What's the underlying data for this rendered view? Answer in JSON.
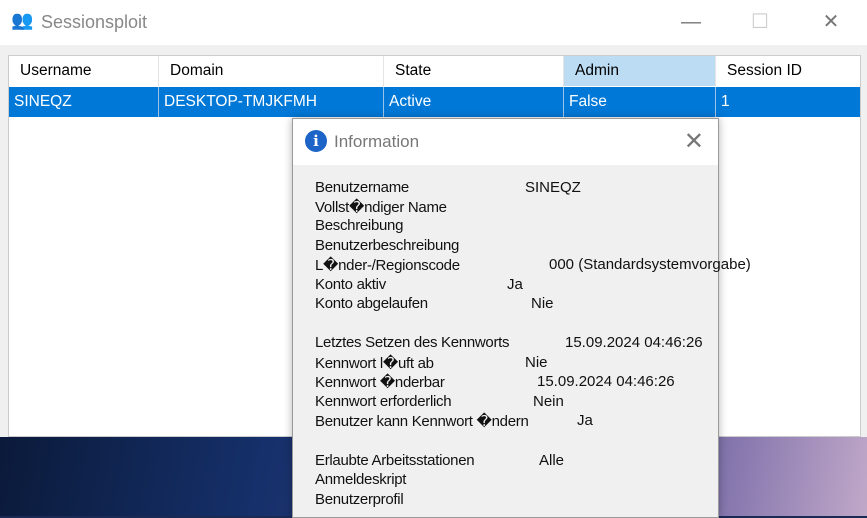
{
  "window": {
    "title": "Sessionsploit",
    "minimize": "—",
    "maximize": "☐",
    "close": "✕"
  },
  "table": {
    "headers": [
      "Username",
      "Domain",
      "State",
      "Admin",
      "Session ID"
    ],
    "rows": [
      [
        "SINEQZ",
        "DESKTOP-TMJKFMH",
        "Active",
        "False",
        "1"
      ]
    ]
  },
  "dialog": {
    "title": "Information",
    "close": "✕",
    "lines": [
      {
        "label": "Benutzername",
        "value": "SINEQZ"
      },
      {
        "label": "Vollst�ndiger Name",
        "value": ""
      },
      {
        "label": "Beschreibung",
        "value": ""
      },
      {
        "label": "Benutzerbeschreibung",
        "value": ""
      },
      {
        "label": "L�nder-/Regionscode",
        "value": "000 (Standardsystemvorgabe)"
      },
      {
        "label": "Konto aktiv",
        "value": "Ja"
      },
      {
        "label": "Konto abgelaufen",
        "value": "Nie"
      },
      {
        "label": "Letztes Setzen des Kennworts",
        "value": "15.09.2024 04:46:26"
      },
      {
        "label": "Kennwort l�uft ab",
        "value": "Nie"
      },
      {
        "label": "Kennwort �nderbar",
        "value": "15.09.2024 04:46:26"
      },
      {
        "label": "Kennwort erforderlich",
        "value": "Nein"
      },
      {
        "label": "Benutzer kann Kennwort �ndern",
        "value": "Ja"
      },
      {
        "label": "Erlaubte Arbeitsstationen",
        "value": "Alle"
      },
      {
        "label": "Anmeldeskript",
        "value": ""
      },
      {
        "label": "Benutzerprofil",
        "value": ""
      }
    ]
  }
}
